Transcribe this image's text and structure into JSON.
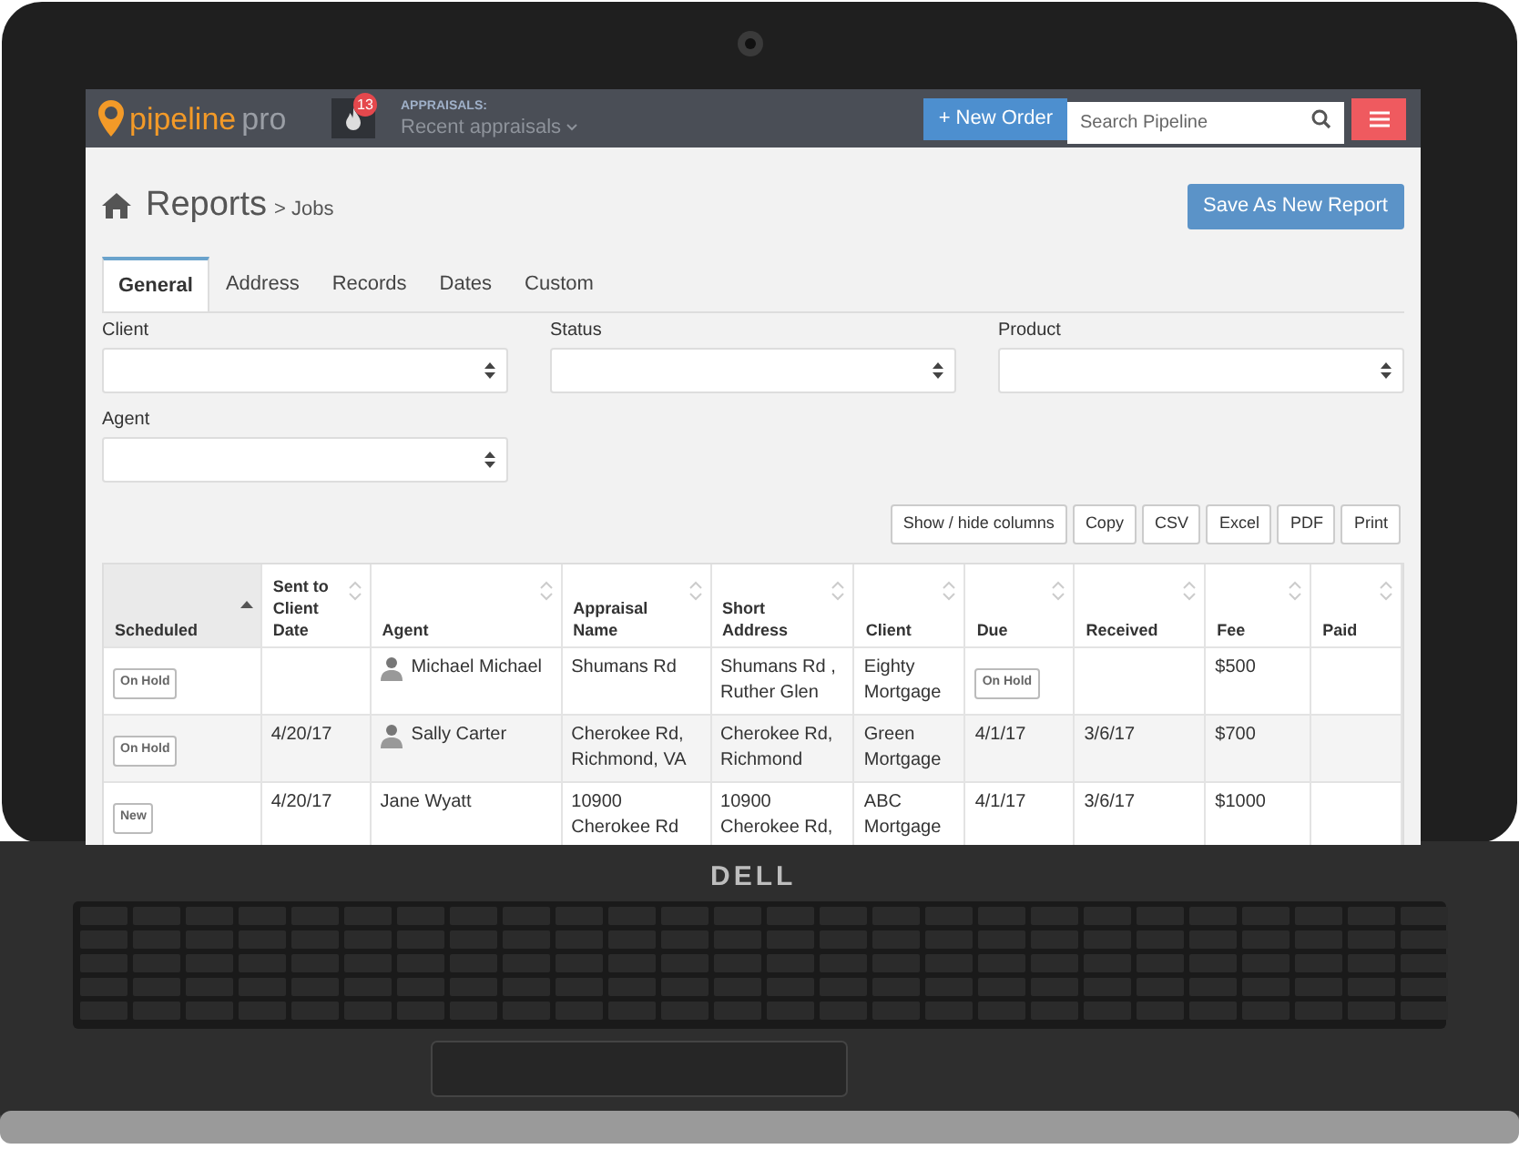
{
  "laptop": {
    "logo": "DELL"
  },
  "topbar": {
    "logo_main": "pipeline",
    "logo_sub": "pro",
    "notification_count": "13",
    "appraisals_label": "APPRAISALS:",
    "appraisals_menu": "Recent appraisals",
    "new_order": "+ New Order",
    "search": {
      "placeholder": "Search Pipeline"
    }
  },
  "header": {
    "title": "Reports",
    "crumb": "> Jobs",
    "save_button": "Save As New Report"
  },
  "tabs": [
    {
      "label": "General",
      "selected": true
    },
    {
      "label": "Address",
      "selected": false
    },
    {
      "label": "Records",
      "selected": false
    },
    {
      "label": "Dates",
      "selected": false
    },
    {
      "label": "Custom",
      "selected": false
    }
  ],
  "filters": [
    {
      "label": "Client"
    },
    {
      "label": "Status"
    },
    {
      "label": "Product"
    },
    {
      "label": "Agent"
    }
  ],
  "table_buttons": [
    "Show / hide columns",
    "Copy",
    "CSV",
    "Excel",
    "PDF",
    "Print"
  ],
  "table": {
    "columns": [
      {
        "label": "Scheduled",
        "sorted": true
      },
      {
        "label": "Sent to Client Date",
        "sorted": false
      },
      {
        "label": "Agent",
        "sorted": false
      },
      {
        "label": "Appraisal Name",
        "sorted": false
      },
      {
        "label": "Short Address",
        "sorted": false
      },
      {
        "label": "Client",
        "sorted": false
      },
      {
        "label": "Due",
        "sorted": false
      },
      {
        "label": "Received",
        "sorted": false
      },
      {
        "label": "Fee",
        "sorted": false
      },
      {
        "label": "Paid",
        "sorted": false
      }
    ],
    "rows": [
      [
        {
          "kind": "badge",
          "text": "On Hold"
        },
        {
          "kind": "text",
          "text": ""
        },
        {
          "kind": "agent",
          "text": "Michael Michael",
          "avatar": true
        },
        {
          "kind": "text",
          "text": "Shumans Rd"
        },
        {
          "kind": "text",
          "text": "Shumans Rd , Ruther Glen"
        },
        {
          "kind": "text",
          "text": "Eighty Mortgage"
        },
        {
          "kind": "badge",
          "text": "On Hold"
        },
        {
          "kind": "text",
          "text": ""
        },
        {
          "kind": "text",
          "text": "$500"
        },
        {
          "kind": "text",
          "text": ""
        }
      ],
      [
        {
          "kind": "badge",
          "text": "On Hold"
        },
        {
          "kind": "text",
          "text": "4/20/17"
        },
        {
          "kind": "agent",
          "text": "Sally Carter",
          "avatar": true
        },
        {
          "kind": "text",
          "text": "Cherokee Rd, Richmond, VA"
        },
        {
          "kind": "text",
          "text": "Cherokee Rd, Richmond"
        },
        {
          "kind": "text",
          "text": "Green Mortgage"
        },
        {
          "kind": "text",
          "text": "4/1/17"
        },
        {
          "kind": "text",
          "text": "3/6/17"
        },
        {
          "kind": "text",
          "text": "$700"
        },
        {
          "kind": "text",
          "text": ""
        }
      ],
      [
        {
          "kind": "badge",
          "text": "New"
        },
        {
          "kind": "text",
          "text": "4/20/17"
        },
        {
          "kind": "agent",
          "text": "Jane Wyatt",
          "avatar": false
        },
        {
          "kind": "text",
          "text": "10900 Cherokee Rd"
        },
        {
          "kind": "text",
          "text": "10900 Cherokee Rd,"
        },
        {
          "kind": "text",
          "text": "ABC Mortgage"
        },
        {
          "kind": "text",
          "text": "4/1/17"
        },
        {
          "kind": "text",
          "text": "3/6/17"
        },
        {
          "kind": "text",
          "text": "$1000"
        },
        {
          "kind": "text",
          "text": ""
        }
      ]
    ]
  }
}
